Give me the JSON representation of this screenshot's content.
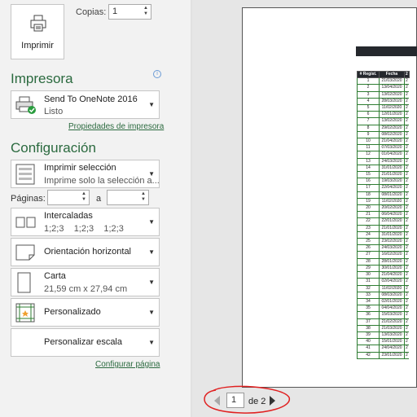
{
  "print": {
    "label": "Imprimir",
    "copies_label": "Copias:",
    "copies_value": "1"
  },
  "printer": {
    "section_title": "Impresora",
    "name": "Send To OneNote 2016",
    "status": "Listo",
    "properties_link": "Propiedades de impresora"
  },
  "settings": {
    "section_title": "Configuración",
    "scope": {
      "title": "Imprimir selección",
      "subtitle": "Imprime solo la selección a..."
    },
    "pages_label": "Páginas:",
    "pages_to": "a",
    "collate": {
      "title": "Intercaladas",
      "subtitle": "1;2;3    1;2;3    1;2;3"
    },
    "orientation": {
      "title": "Orientación horizontal"
    },
    "paper": {
      "title": "Carta",
      "subtitle": "21,59 cm x 27,94 cm"
    },
    "margins": {
      "title": "Personalizado"
    },
    "scaling": {
      "title": "Personalizar escala"
    },
    "page_setup_link": "Configurar página"
  },
  "preview": {
    "headers": [
      "# Regist.",
      "Fecha",
      "2"
    ],
    "rows": [
      [
        "1",
        "21/03/2020"
      ],
      [
        "2",
        "13/04/2020"
      ],
      [
        "3",
        "13/02/2020"
      ],
      [
        "4",
        "28/03/2020"
      ],
      [
        "5",
        "11/02/2020"
      ],
      [
        "6",
        "12/01/2020"
      ],
      [
        "7",
        "13/02/2020"
      ],
      [
        "8",
        "29/02/2020"
      ],
      [
        "9",
        "08/02/2020"
      ],
      [
        "10",
        "21/04/2020"
      ],
      [
        "11",
        "07/03/2020"
      ],
      [
        "12",
        "01/04/2020"
      ],
      [
        "13",
        "24/03/2020"
      ],
      [
        "14",
        "31/01/2020"
      ],
      [
        "15",
        "21/01/2020"
      ],
      [
        "16",
        "19/03/2020"
      ],
      [
        "17",
        "22/04/2020"
      ],
      [
        "18",
        "08/01/2020"
      ],
      [
        "19",
        "11/02/2020"
      ],
      [
        "20",
        "20/02/2020"
      ],
      [
        "21",
        "06/04/2020"
      ],
      [
        "22",
        "22/01/2020"
      ],
      [
        "23",
        "21/01/2020"
      ],
      [
        "24",
        "31/01/2020"
      ],
      [
        "25",
        "23/02/2020"
      ],
      [
        "26",
        "24/03/2020"
      ],
      [
        "27",
        "16/02/2020"
      ],
      [
        "28",
        "28/01/2020"
      ],
      [
        "29",
        "30/01/2020"
      ],
      [
        "30",
        "21/04/2020"
      ],
      [
        "31",
        "02/04/2020"
      ],
      [
        "32",
        "11/02/2020"
      ],
      [
        "33",
        "08/03/2020"
      ],
      [
        "34",
        "02/01/2020"
      ],
      [
        "35",
        "04/04/2020"
      ],
      [
        "36",
        "15/03/2020"
      ],
      [
        "37",
        "21/02/2020"
      ],
      [
        "38",
        "21/03/2020"
      ],
      [
        "39",
        "13/03/2020"
      ],
      [
        "40",
        "15/01/2020"
      ],
      [
        "41",
        "24/04/2020"
      ],
      [
        "42",
        "23/01/2020"
      ]
    ],
    "col3_prefix": "2"
  },
  "pager": {
    "current": "1",
    "of_label": "de 2"
  },
  "colors": {
    "accent": "#2b6a3f",
    "annotation": "#e02020",
    "header_dark": "#25282d"
  }
}
